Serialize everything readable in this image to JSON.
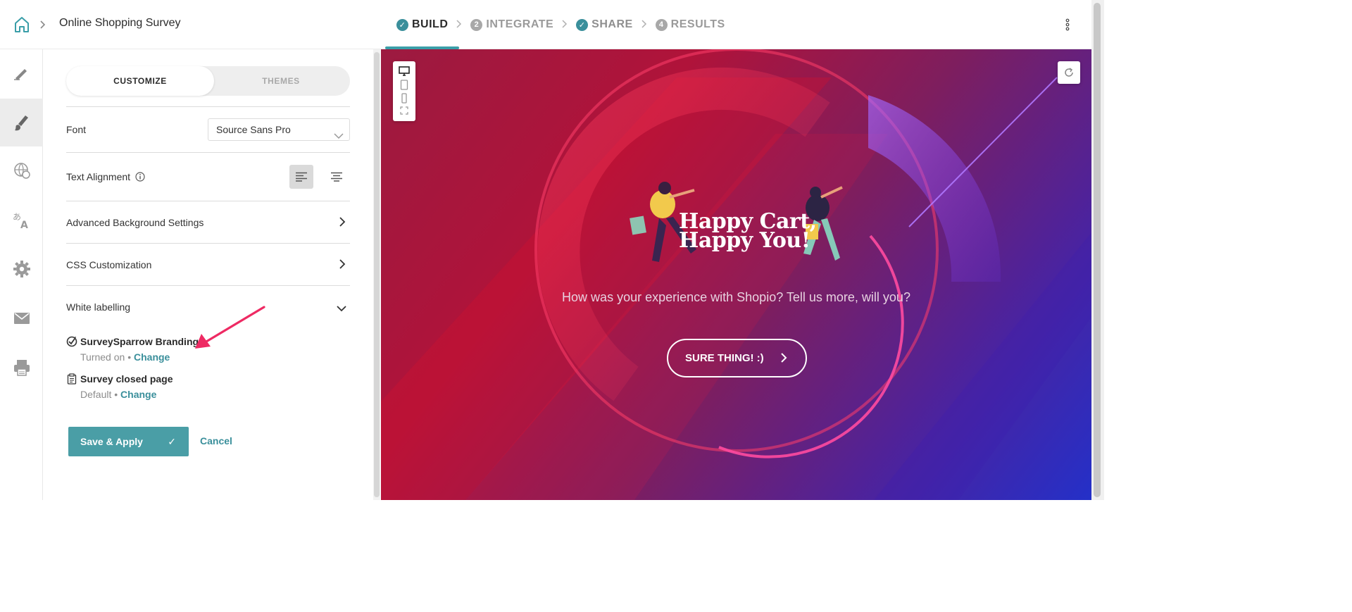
{
  "header": {
    "survey_title": "Online Shopping Survey",
    "steps": [
      {
        "label": "BUILD",
        "badge": "✓",
        "state": "done-active"
      },
      {
        "label": "INTEGRATE",
        "badge": "2",
        "state": "numbered"
      },
      {
        "label": "SHARE",
        "badge": "✓",
        "state": "done"
      },
      {
        "label": "RESULTS",
        "badge": "4",
        "state": "numbered"
      }
    ]
  },
  "rail": {
    "icons": [
      "pencil-icon",
      "paint-brush-icon",
      "globe-icon",
      "translate-icon",
      "gear-icon",
      "mail-icon",
      "printer-icon"
    ],
    "active": "paint-brush-icon"
  },
  "panel": {
    "tabs": {
      "customize": "CUSTOMIZE",
      "themes": "THEMES"
    },
    "font": {
      "label": "Font",
      "value": "Source Sans Pro"
    },
    "text_alignment": {
      "label": "Text Alignment",
      "selected": "left"
    },
    "advanced_background": {
      "label": "Advanced Background Settings"
    },
    "css_customization": {
      "label": "CSS Customization"
    },
    "white_labelling": {
      "label": "White labelling",
      "items": [
        {
          "title": "SurveySparrow Branding",
          "status": "Turned on",
          "sep": " • ",
          "action": "Change"
        },
        {
          "title": "Survey closed page",
          "status": "Default",
          "sep": " • ",
          "action": "Change"
        }
      ]
    },
    "save_label": "Save & Apply",
    "save_check": "✓",
    "cancel_label": "Cancel"
  },
  "preview": {
    "headline_line1": "Happy Cart,",
    "headline_line2": "Happy You!",
    "question": "How was your experience with Shopio? Tell us more, will you?",
    "cta_label": "SURE THING! :)",
    "cta_arrow": "›",
    "colors": {
      "accent": "#4a9ea6",
      "cta_border": "#ffffff",
      "bg_start": "#b0133a",
      "bg_end": "#2430c8"
    }
  }
}
